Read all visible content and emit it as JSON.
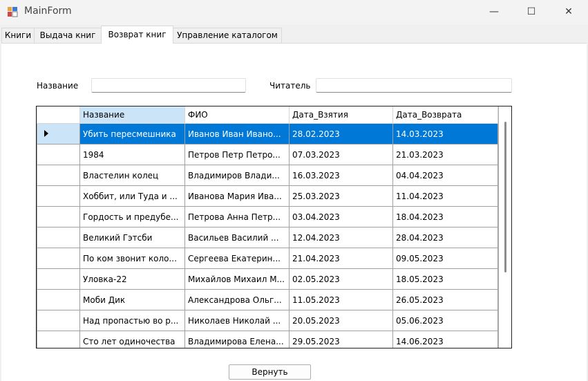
{
  "window": {
    "title": "MainForm",
    "controls": {
      "minimize": "—",
      "maximize": "☐",
      "close": "✕"
    }
  },
  "tabs": [
    {
      "label": "Книги"
    },
    {
      "label": "Выдача книг"
    },
    {
      "label": "Возврат книг"
    },
    {
      "label": "Управление каталогом"
    }
  ],
  "active_tab": "Возврат книг",
  "filters": {
    "title_label": "Название",
    "title_value": "",
    "reader_label": "Читатель",
    "reader_value": ""
  },
  "grid": {
    "columns": [
      "Название",
      "ФИО",
      "Дата_Взятия",
      "Дата_Возврата"
    ],
    "rows": [
      [
        "Убить пересмешника",
        "Иванов Иван Ивано...",
        "28.02.2023",
        "14.03.2023"
      ],
      [
        "1984",
        "Петров Петр Петро...",
        "07.03.2023",
        "21.03.2023"
      ],
      [
        "Властелин колец",
        "Владимиров Влади...",
        "16.03.2023",
        "04.04.2023"
      ],
      [
        "Хоббит, или Туда и ...",
        "Иванова Мария Ива...",
        "25.03.2023",
        "11.04.2023"
      ],
      [
        "Гордость и предубе...",
        "Петрова Анна Петр...",
        "03.04.2023",
        "18.04.2023"
      ],
      [
        "Великий Гэтсби",
        "Васильев Василий ...",
        "12.04.2023",
        "28.04.2023"
      ],
      [
        "По ком звонит коло...",
        "Сергеева Екатерин...",
        "21.04.2023",
        "09.05.2023"
      ],
      [
        "Уловка-22",
        "Михайлов Михаил М...",
        "02.05.2023",
        "18.05.2023"
      ],
      [
        "Моби Дик",
        "Александрова Ольг...",
        "11.05.2023",
        "26.05.2023"
      ],
      [
        "Над пропастью во р...",
        "Николаев Николай ...",
        "20.05.2023",
        "05.06.2023"
      ],
      [
        "Сто лет одиночества",
        "Владимирова Елена...",
        "29.05.2023",
        "14.06.2023"
      ]
    ]
  },
  "buttons": {
    "return_label": "Вернуть"
  },
  "colors": {
    "selection": "#0078d7",
    "selection_header": "#cce4f7"
  }
}
